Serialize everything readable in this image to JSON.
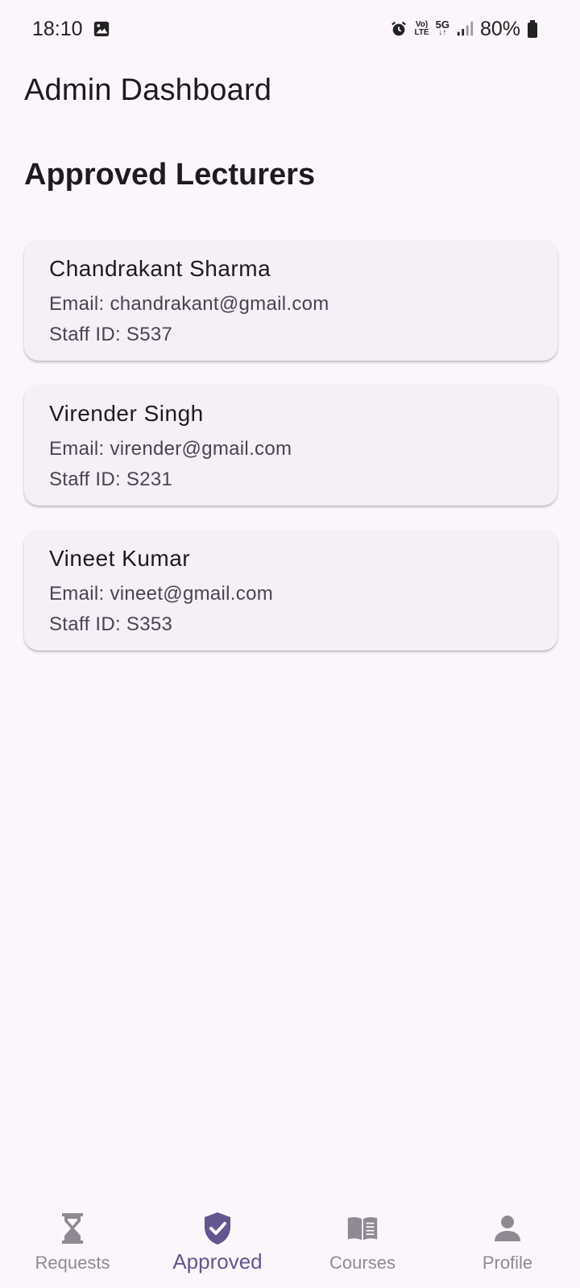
{
  "status_bar": {
    "time": "18:10",
    "battery": "80%",
    "net_top": "Vo)",
    "net_bottom": "LTE",
    "net_5g": "5G"
  },
  "app_bar": {
    "title": "Admin Dashboard"
  },
  "section": {
    "title": "Approved Lecturers"
  },
  "lecturers": [
    {
      "name": "Chandrakant Sharma",
      "email": "Email: chandrakant@gmail.com",
      "staff_id": "Staff ID: S537"
    },
    {
      "name": "Virender Singh",
      "email": "Email: virender@gmail.com",
      "staff_id": "Staff ID: S231"
    },
    {
      "name": "Vineet Kumar",
      "email": "Email: vineet@gmail.com",
      "staff_id": "Staff ID: S353"
    }
  ],
  "bottom_nav": {
    "items": [
      {
        "label": "Requests",
        "icon": "hourglass-icon",
        "active": false
      },
      {
        "label": "Approved",
        "icon": "verified-shield-icon",
        "active": true
      },
      {
        "label": "Courses",
        "icon": "book-icon",
        "active": false
      },
      {
        "label": "Profile",
        "icon": "person-icon",
        "active": false
      }
    ]
  },
  "colors": {
    "background": "#fcf6fc",
    "card": "#f5f0f7",
    "accent": "#65558f",
    "inactive": "#8e8a93"
  }
}
